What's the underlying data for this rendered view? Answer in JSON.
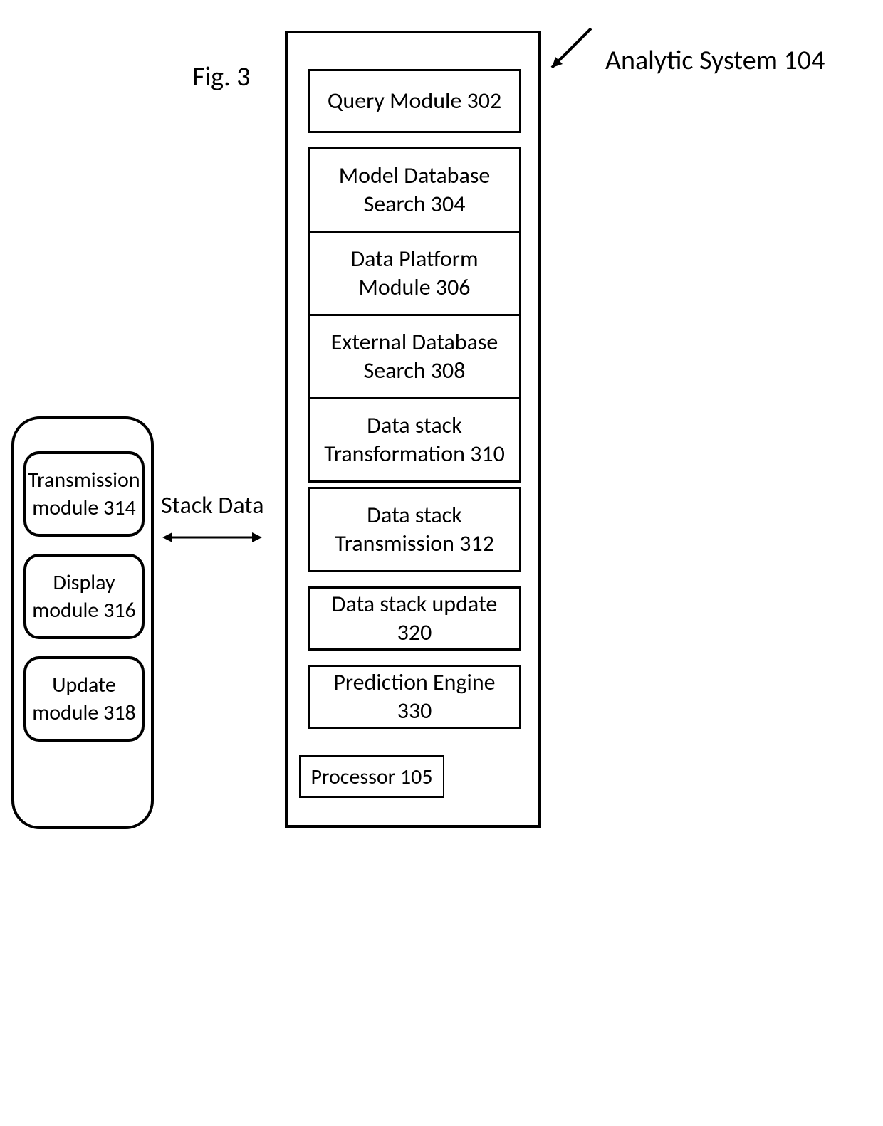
{
  "figure_label": "Fig. 3",
  "system_label": "Analytic System 104",
  "connector_label": "Stack Data",
  "analytic_system": {
    "modules": [
      "Query Module 302",
      "Model Database Search 304",
      "Data Platform Module 306",
      "External Database Search 308",
      "Data stack Transformation 310",
      "Data stack Transmission 312",
      "Data stack update 320",
      "Prediction Engine  330"
    ],
    "processor": "Processor 105"
  },
  "device": {
    "modules": [
      "Transmission module 314",
      "Display module 316",
      "Update module 318"
    ]
  }
}
